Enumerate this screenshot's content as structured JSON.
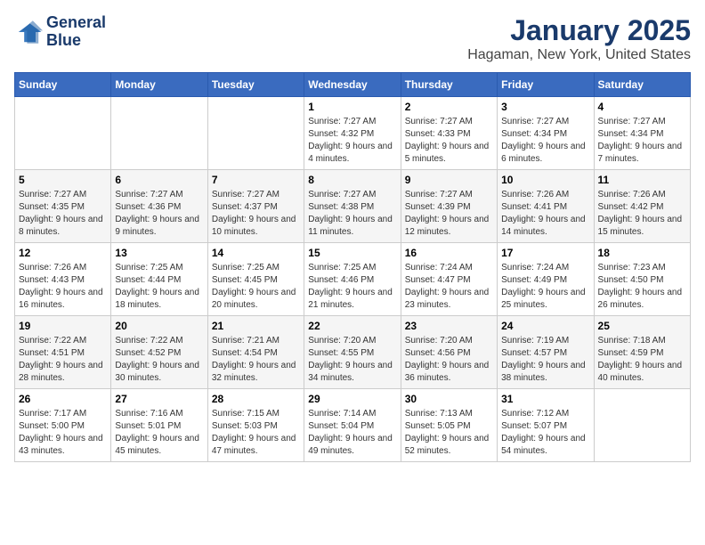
{
  "header": {
    "logo_line1": "General",
    "logo_line2": "Blue",
    "title": "January 2025",
    "subtitle": "Hagaman, New York, United States"
  },
  "days_of_week": [
    "Sunday",
    "Monday",
    "Tuesday",
    "Wednesday",
    "Thursday",
    "Friday",
    "Saturday"
  ],
  "weeks": [
    [
      {
        "day": "",
        "info": ""
      },
      {
        "day": "",
        "info": ""
      },
      {
        "day": "",
        "info": ""
      },
      {
        "day": "1",
        "info": "Sunrise: 7:27 AM\nSunset: 4:32 PM\nDaylight: 9 hours and 4 minutes."
      },
      {
        "day": "2",
        "info": "Sunrise: 7:27 AM\nSunset: 4:33 PM\nDaylight: 9 hours and 5 minutes."
      },
      {
        "day": "3",
        "info": "Sunrise: 7:27 AM\nSunset: 4:34 PM\nDaylight: 9 hours and 6 minutes."
      },
      {
        "day": "4",
        "info": "Sunrise: 7:27 AM\nSunset: 4:34 PM\nDaylight: 9 hours and 7 minutes."
      }
    ],
    [
      {
        "day": "5",
        "info": "Sunrise: 7:27 AM\nSunset: 4:35 PM\nDaylight: 9 hours and 8 minutes."
      },
      {
        "day": "6",
        "info": "Sunrise: 7:27 AM\nSunset: 4:36 PM\nDaylight: 9 hours and 9 minutes."
      },
      {
        "day": "7",
        "info": "Sunrise: 7:27 AM\nSunset: 4:37 PM\nDaylight: 9 hours and 10 minutes."
      },
      {
        "day": "8",
        "info": "Sunrise: 7:27 AM\nSunset: 4:38 PM\nDaylight: 9 hours and 11 minutes."
      },
      {
        "day": "9",
        "info": "Sunrise: 7:27 AM\nSunset: 4:39 PM\nDaylight: 9 hours and 12 minutes."
      },
      {
        "day": "10",
        "info": "Sunrise: 7:26 AM\nSunset: 4:41 PM\nDaylight: 9 hours and 14 minutes."
      },
      {
        "day": "11",
        "info": "Sunrise: 7:26 AM\nSunset: 4:42 PM\nDaylight: 9 hours and 15 minutes."
      }
    ],
    [
      {
        "day": "12",
        "info": "Sunrise: 7:26 AM\nSunset: 4:43 PM\nDaylight: 9 hours and 16 minutes."
      },
      {
        "day": "13",
        "info": "Sunrise: 7:25 AM\nSunset: 4:44 PM\nDaylight: 9 hours and 18 minutes."
      },
      {
        "day": "14",
        "info": "Sunrise: 7:25 AM\nSunset: 4:45 PM\nDaylight: 9 hours and 20 minutes."
      },
      {
        "day": "15",
        "info": "Sunrise: 7:25 AM\nSunset: 4:46 PM\nDaylight: 9 hours and 21 minutes."
      },
      {
        "day": "16",
        "info": "Sunrise: 7:24 AM\nSunset: 4:47 PM\nDaylight: 9 hours and 23 minutes."
      },
      {
        "day": "17",
        "info": "Sunrise: 7:24 AM\nSunset: 4:49 PM\nDaylight: 9 hours and 25 minutes."
      },
      {
        "day": "18",
        "info": "Sunrise: 7:23 AM\nSunset: 4:50 PM\nDaylight: 9 hours and 26 minutes."
      }
    ],
    [
      {
        "day": "19",
        "info": "Sunrise: 7:22 AM\nSunset: 4:51 PM\nDaylight: 9 hours and 28 minutes."
      },
      {
        "day": "20",
        "info": "Sunrise: 7:22 AM\nSunset: 4:52 PM\nDaylight: 9 hours and 30 minutes."
      },
      {
        "day": "21",
        "info": "Sunrise: 7:21 AM\nSunset: 4:54 PM\nDaylight: 9 hours and 32 minutes."
      },
      {
        "day": "22",
        "info": "Sunrise: 7:20 AM\nSunset: 4:55 PM\nDaylight: 9 hours and 34 minutes."
      },
      {
        "day": "23",
        "info": "Sunrise: 7:20 AM\nSunset: 4:56 PM\nDaylight: 9 hours and 36 minutes."
      },
      {
        "day": "24",
        "info": "Sunrise: 7:19 AM\nSunset: 4:57 PM\nDaylight: 9 hours and 38 minutes."
      },
      {
        "day": "25",
        "info": "Sunrise: 7:18 AM\nSunset: 4:59 PM\nDaylight: 9 hours and 40 minutes."
      }
    ],
    [
      {
        "day": "26",
        "info": "Sunrise: 7:17 AM\nSunset: 5:00 PM\nDaylight: 9 hours and 43 minutes."
      },
      {
        "day": "27",
        "info": "Sunrise: 7:16 AM\nSunset: 5:01 PM\nDaylight: 9 hours and 45 minutes."
      },
      {
        "day": "28",
        "info": "Sunrise: 7:15 AM\nSunset: 5:03 PM\nDaylight: 9 hours and 47 minutes."
      },
      {
        "day": "29",
        "info": "Sunrise: 7:14 AM\nSunset: 5:04 PM\nDaylight: 9 hours and 49 minutes."
      },
      {
        "day": "30",
        "info": "Sunrise: 7:13 AM\nSunset: 5:05 PM\nDaylight: 9 hours and 52 minutes."
      },
      {
        "day": "31",
        "info": "Sunrise: 7:12 AM\nSunset: 5:07 PM\nDaylight: 9 hours and 54 minutes."
      },
      {
        "day": "",
        "info": ""
      }
    ]
  ]
}
